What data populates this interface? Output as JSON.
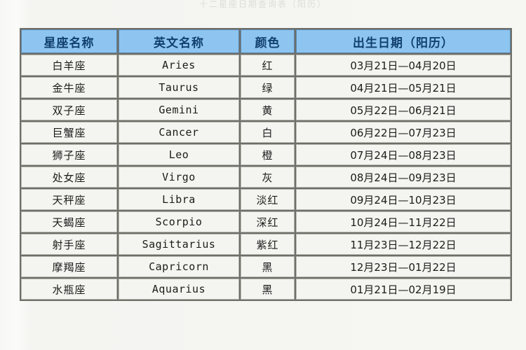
{
  "page": {
    "top_caption": "十二星座日期查询表（阳历）",
    "background_color": "#f6f6f3"
  },
  "table": {
    "header_bg": "#8dc5f0",
    "header_text_color": "#12406d",
    "cell_bg": "#f4f4f0",
    "grid_color": "#6e6e68",
    "columns": [
      "星座名称",
      "英文名称",
      "颜色",
      "出生日期（阳历）"
    ],
    "rows": [
      {
        "name": "白羊座",
        "english": "Aries",
        "color": "红",
        "date": "03月21日—04月20日"
      },
      {
        "name": "金牛座",
        "english": "Taurus",
        "color": "绿",
        "date": "04月21日—05月21日"
      },
      {
        "name": "双子座",
        "english": "Gemini",
        "color": "黄",
        "date": "05月22日—06月21日"
      },
      {
        "name": "巨蟹座",
        "english": "Cancer",
        "color": "白",
        "date": "06月22日—07月23日"
      },
      {
        "name": "狮子座",
        "english": "Leo",
        "color": "橙",
        "date": "07月24日—08月23日"
      },
      {
        "name": "处女座",
        "english": "Virgo",
        "color": "灰",
        "date": "08月24日—09月23日"
      },
      {
        "name": "天秤座",
        "english": "Libra",
        "color": "淡红",
        "date": "09月24日—10月23日"
      },
      {
        "name": "天蝎座",
        "english": "Scorpio",
        "color": "深红",
        "date": "10月24日—11月22日"
      },
      {
        "name": "射手座",
        "english": "Sagittarius",
        "color": "紫红",
        "date": "11月23日—12月22日"
      },
      {
        "name": "摩羯座",
        "english": "Capricorn",
        "color": "黑",
        "date": "12月23日—01月22日"
      },
      {
        "name": "水瓶座",
        "english": "Aquarius",
        "color": "黑",
        "date": "01月21日—02月19日"
      }
    ]
  }
}
